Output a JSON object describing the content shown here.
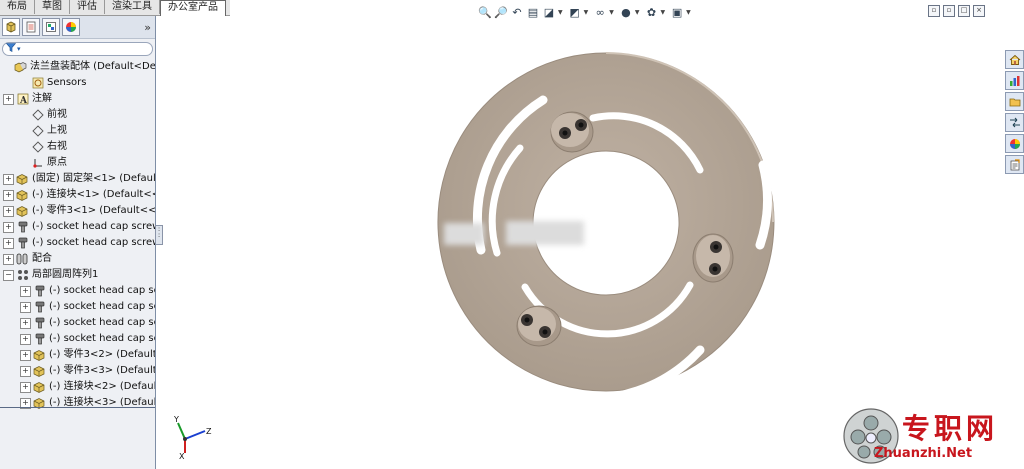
{
  "top_tabs": [
    "布局",
    "草图",
    "评估",
    "渲染工具",
    "办公室产品"
  ],
  "filter": {
    "icon": "funnel-icon"
  },
  "tree": [
    {
      "label": "法兰盘装配体 (Default<Default",
      "icon": "assembly-icon",
      "expand": "",
      "indent": 0
    },
    {
      "label": "Sensors",
      "icon": "sensor-icon",
      "expand": "",
      "indent": 1
    },
    {
      "label": "注解",
      "icon": "annotation-icon",
      "expand": "+",
      "indent": 0
    },
    {
      "label": "前视",
      "icon": "plane-icon",
      "expand": "",
      "indent": 1
    },
    {
      "label": "上视",
      "icon": "plane-icon",
      "expand": "",
      "indent": 1
    },
    {
      "label": "右视",
      "icon": "plane-icon",
      "expand": "",
      "indent": 1
    },
    {
      "label": "原点",
      "icon": "origin-icon",
      "expand": "",
      "indent": 1
    },
    {
      "label": "(固定) 固定架<1> (Default<",
      "icon": "part-icon",
      "expand": "+",
      "indent": 0
    },
    {
      "label": "(-) 连接块<1> (Default<<D",
      "icon": "part-icon",
      "expand": "+",
      "indent": 0
    },
    {
      "label": "(-) 零件3<1> (Default<<De",
      "icon": "part-icon",
      "expand": "+",
      "indent": 0
    },
    {
      "label": "(-) socket head cap screw",
      "icon": "screw-icon",
      "expand": "+",
      "indent": 0
    },
    {
      "label": "(-) socket head cap screw",
      "icon": "screw-icon",
      "expand": "+",
      "indent": 0
    },
    {
      "label": "配合",
      "icon": "mate-icon",
      "expand": "+",
      "indent": 0
    },
    {
      "label": "局部圆周阵列1",
      "icon": "pattern-icon",
      "expand": "−",
      "indent": 0
    },
    {
      "label": "(-) socket head cap scr",
      "icon": "screw-icon",
      "expand": "+",
      "indent": 1
    },
    {
      "label": "(-) socket head cap scr",
      "icon": "screw-icon",
      "expand": "+",
      "indent": 1
    },
    {
      "label": "(-) socket head cap scr",
      "icon": "screw-icon",
      "expand": "+",
      "indent": 1
    },
    {
      "label": "(-) socket head cap scr",
      "icon": "screw-icon",
      "expand": "+",
      "indent": 1
    },
    {
      "label": "(-) 零件3<2> (Default<",
      "icon": "part-icon",
      "expand": "+",
      "indent": 1
    },
    {
      "label": "(-) 零件3<3> (Default<",
      "icon": "part-icon",
      "expand": "+",
      "indent": 1
    },
    {
      "label": "(-) 连接块<2> (Default<",
      "icon": "part-icon",
      "expand": "+",
      "indent": 1
    },
    {
      "label": "(-) 连接块<3> (Default<",
      "icon": "part-icon",
      "expand": "+",
      "indent": 1
    }
  ],
  "view_toolbar": [
    {
      "icon": "zoom-to-fit-icon",
      "glyph": "🔍",
      "dropdown": false
    },
    {
      "icon": "zoom-to-area-icon",
      "glyph": "🔎",
      "dropdown": false
    },
    {
      "icon": "previous-view-icon",
      "glyph": "↶",
      "dropdown": false
    },
    {
      "icon": "section-view-icon",
      "glyph": "▤",
      "dropdown": false
    },
    {
      "icon": "view-orientation-icon",
      "glyph": "◪",
      "dropdown": true
    },
    {
      "icon": "display-style-icon",
      "glyph": "◩",
      "dropdown": true
    },
    {
      "icon": "hide-show-items-icon",
      "glyph": "∞",
      "dropdown": true
    },
    {
      "icon": "edit-appearance-icon",
      "glyph": "●",
      "dropdown": true
    },
    {
      "icon": "apply-scene-icon",
      "glyph": "✿",
      "dropdown": true
    },
    {
      "icon": "view-settings-icon",
      "glyph": "▣",
      "dropdown": true
    }
  ],
  "window_buttons": [
    "restore-icon",
    "restore-icon",
    "maximize-icon",
    "close-icon"
  ],
  "taskpane": [
    "home-icon",
    "resources-icon",
    "folder-icon",
    "design-library-icon",
    "appearances-icon",
    "custom-properties-icon"
  ],
  "triad": {
    "x": "X",
    "y": "Y",
    "z": "Z"
  },
  "watermark": {
    "cn": "专职网",
    "url": "Zhuanzhi.Net"
  },
  "colors": {
    "part": "#b0a193",
    "panel": "#eef0f4",
    "watermark": "#c8161d"
  }
}
